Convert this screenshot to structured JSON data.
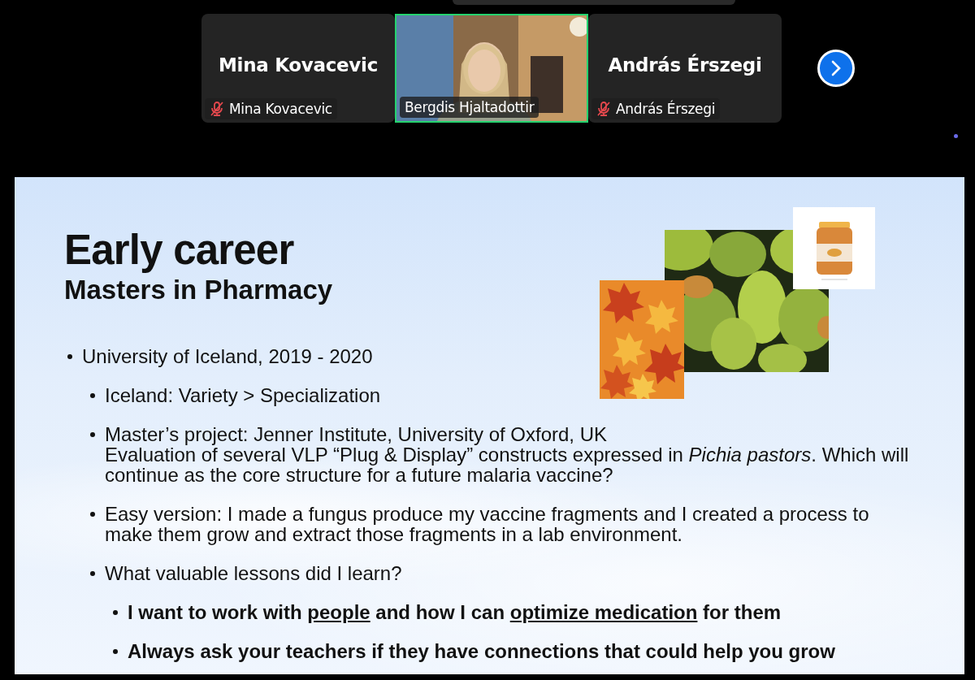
{
  "participants": [
    {
      "name": "Mina Kovacevic",
      "caption": "Mina Kovacevic",
      "kind": "avatar",
      "muted": true,
      "speaking": false
    },
    {
      "caption": "Bergdis Hjaltadottir",
      "kind": "video",
      "muted": false,
      "speaking": true
    },
    {
      "name": "András Érszegi",
      "caption": "András Érszegi",
      "kind": "avatar",
      "muted": true,
      "speaking": false
    }
  ],
  "slide": {
    "title": "Early career",
    "subtitle": "Masters in Pharmacy",
    "bullets": [
      {
        "lines": [
          "University of Iceland, 2019 - 2020"
        ],
        "children": [
          {
            "lines": [
              "Iceland: Variety > Specialization"
            ]
          },
          {
            "lines": [
              "Master’s project: Jenner Institute, University of Oxford, UK",
              "Evaluation of several VLP “Plug & Display” constructs expressed in *Pichia pastors*. Which will continue as the core structure for a future malaria vaccine?"
            ]
          },
          {
            "lines": [
              "Easy version: I made a fungus produce my vaccine fragments and I created a process to make them grow and extract those fragments in a lab environment."
            ]
          },
          {
            "lines": [
              "What valuable lessons did I learn?"
            ],
            "children": [
              {
                "segments": [
                  {
                    "text": "I want to work with ",
                    "underline": false
                  },
                  {
                    "text": "people",
                    "underline": true
                  },
                  {
                    "text": " and how I can ",
                    "underline": false
                  },
                  {
                    "text": "optimize medication",
                    "underline": true
                  },
                  {
                    "text": " for them",
                    "underline": false
                  }
                ]
              },
              {
                "segments": [
                  {
                    "text": "Always ask your teachers if they have connections that could help you grow",
                    "underline": false
                  }
                ]
              }
            ]
          }
        ]
      }
    ]
  }
}
